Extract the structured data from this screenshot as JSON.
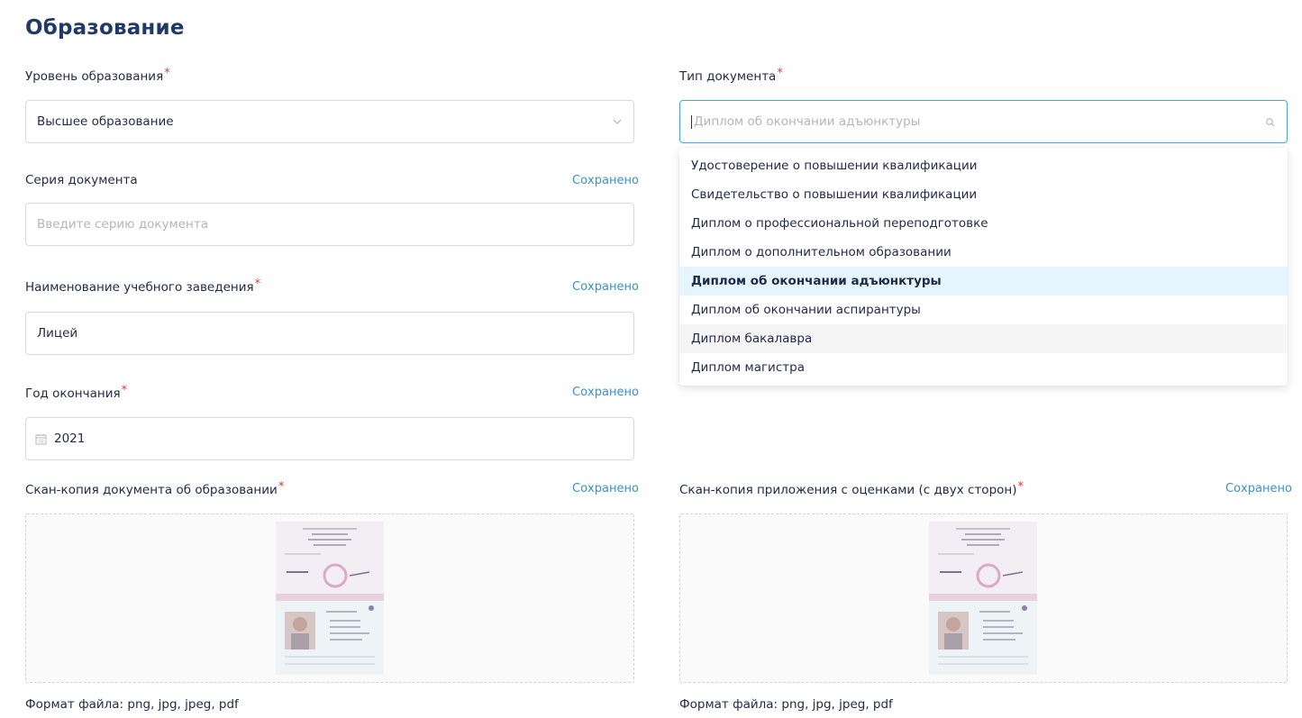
{
  "section": {
    "title": "Образование"
  },
  "required_mark": "*",
  "saved_label": "Сохранено",
  "education_level": {
    "label": "Уровень образования",
    "value": "Высшее образование"
  },
  "document_type": {
    "label": "Тип документа",
    "placeholder": "Диплом об окончании адъюнктуры",
    "options": [
      "Удостоверение о повышении квалификации",
      "Свидетельство о повышении квалификации",
      "Диплом о профессиональной переподготовке",
      "Диплом о дополнительном образовании",
      "Диплом об окончании адъюнктуры",
      "Диплом об окончании аспирантуры",
      "Диплом бакалавра",
      "Диплом магистра"
    ],
    "selected_index": 4,
    "hovered_index": 6
  },
  "document_series": {
    "label": "Серия документа",
    "placeholder": "Введите серию документа"
  },
  "institution": {
    "label": "Наименование учебного заведения",
    "value": "Лицей"
  },
  "graduation_year": {
    "label": "Год окончания",
    "value": "2021"
  },
  "scan_document": {
    "label": "Скан-копия документа об образовании",
    "format": "Формат файла: png, jpg, jpeg, pdf"
  },
  "scan_grades": {
    "label": "Скан-копия приложения с оценками (с двух сторон)",
    "format": "Формат файла: png, jpg, jpeg, pdf"
  },
  "icons": {
    "select_arrow": "chevron-down-icon",
    "search": "search-icon",
    "calendar": "calendar-icon"
  }
}
